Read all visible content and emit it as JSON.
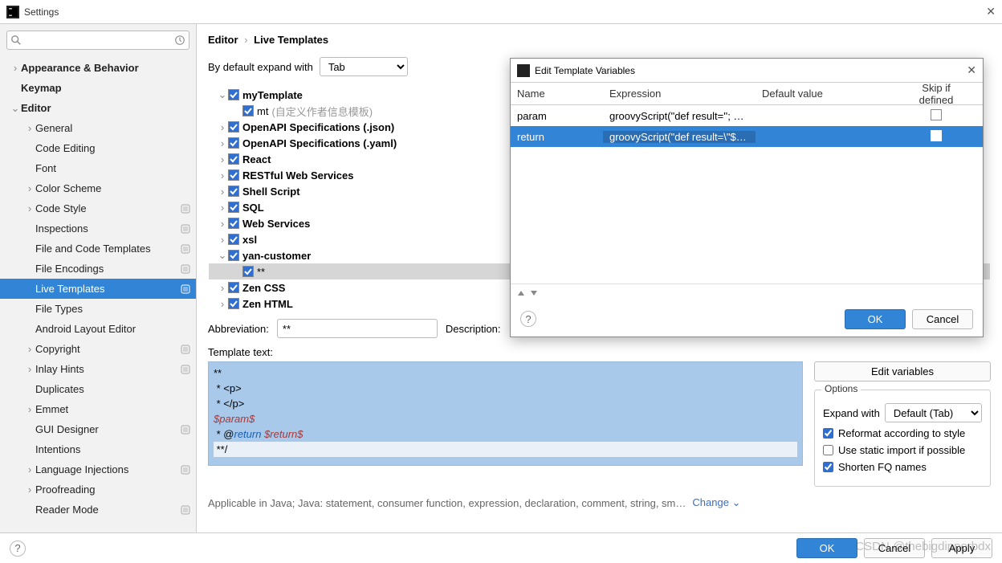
{
  "window": {
    "title": "Settings"
  },
  "breadcrumb": {
    "root": "Editor",
    "leaf": "Live Templates",
    "sep": "›"
  },
  "expand_row": {
    "label": "By default expand with",
    "value": "Tab"
  },
  "sidebar": {
    "items": [
      {
        "label": "Appearance & Behavior",
        "depth": 0,
        "chevron": "›",
        "bold": true,
        "badge": false
      },
      {
        "label": "Keymap",
        "depth": 0,
        "chevron": "",
        "bold": true,
        "badge": false
      },
      {
        "label": "Editor",
        "depth": 0,
        "chevron": "⌄",
        "bold": true,
        "badge": false
      },
      {
        "label": "General",
        "depth": 1,
        "chevron": "›",
        "bold": false,
        "badge": false
      },
      {
        "label": "Code Editing",
        "depth": 1,
        "chevron": "",
        "bold": false,
        "badge": false
      },
      {
        "label": "Font",
        "depth": 1,
        "chevron": "",
        "bold": false,
        "badge": false
      },
      {
        "label": "Color Scheme",
        "depth": 1,
        "chevron": "›",
        "bold": false,
        "badge": false
      },
      {
        "label": "Code Style",
        "depth": 1,
        "chevron": "›",
        "bold": false,
        "badge": true
      },
      {
        "label": "Inspections",
        "depth": 1,
        "chevron": "",
        "bold": false,
        "badge": true
      },
      {
        "label": "File and Code Templates",
        "depth": 1,
        "chevron": "",
        "bold": false,
        "badge": true
      },
      {
        "label": "File Encodings",
        "depth": 1,
        "chevron": "",
        "bold": false,
        "badge": true
      },
      {
        "label": "Live Templates",
        "depth": 1,
        "chevron": "",
        "bold": false,
        "badge": true,
        "selected": true
      },
      {
        "label": "File Types",
        "depth": 1,
        "chevron": "",
        "bold": false,
        "badge": false
      },
      {
        "label": "Android Layout Editor",
        "depth": 1,
        "chevron": "",
        "bold": false,
        "badge": false
      },
      {
        "label": "Copyright",
        "depth": 1,
        "chevron": "›",
        "bold": false,
        "badge": true
      },
      {
        "label": "Inlay Hints",
        "depth": 1,
        "chevron": "›",
        "bold": false,
        "badge": true
      },
      {
        "label": "Duplicates",
        "depth": 1,
        "chevron": "",
        "bold": false,
        "badge": false
      },
      {
        "label": "Emmet",
        "depth": 1,
        "chevron": "›",
        "bold": false,
        "badge": false
      },
      {
        "label": "GUI Designer",
        "depth": 1,
        "chevron": "",
        "bold": false,
        "badge": true
      },
      {
        "label": "Intentions",
        "depth": 1,
        "chevron": "",
        "bold": false,
        "badge": false
      },
      {
        "label": "Language Injections",
        "depth": 1,
        "chevron": "›",
        "bold": false,
        "badge": true
      },
      {
        "label": "Proofreading",
        "depth": 1,
        "chevron": "›",
        "bold": false,
        "badge": false
      },
      {
        "label": "Reader Mode",
        "depth": 1,
        "chevron": "",
        "bold": false,
        "badge": true
      }
    ]
  },
  "templates": [
    {
      "label": "myTemplate",
      "depth": 0,
      "chevron": "⌄",
      "bold": true
    },
    {
      "label": "mt",
      "depth": 1,
      "chevron": "",
      "bold": false,
      "desc": "(自定义作者信息模板)"
    },
    {
      "label": "OpenAPI Specifications (.json)",
      "depth": 0,
      "chevron": "›",
      "bold": true
    },
    {
      "label": "OpenAPI Specifications (.yaml)",
      "depth": 0,
      "chevron": "›",
      "bold": true
    },
    {
      "label": "React",
      "depth": 0,
      "chevron": "›",
      "bold": true
    },
    {
      "label": "RESTful Web Services",
      "depth": 0,
      "chevron": "›",
      "bold": true
    },
    {
      "label": "Shell Script",
      "depth": 0,
      "chevron": "›",
      "bold": true
    },
    {
      "label": "SQL",
      "depth": 0,
      "chevron": "›",
      "bold": true
    },
    {
      "label": "Web Services",
      "depth": 0,
      "chevron": "›",
      "bold": true
    },
    {
      "label": "xsl",
      "depth": 0,
      "chevron": "›",
      "bold": true
    },
    {
      "label": "yan-customer",
      "depth": 0,
      "chevron": "⌄",
      "bold": true
    },
    {
      "label": "**",
      "depth": 1,
      "chevron": "",
      "bold": false,
      "selected": true
    },
    {
      "label": "Zen CSS",
      "depth": 0,
      "chevron": "›",
      "bold": true
    },
    {
      "label": "Zen HTML",
      "depth": 0,
      "chevron": "›",
      "bold": true
    }
  ],
  "abbrev": {
    "label": "Abbreviation:",
    "value": "**",
    "desc_label": "Description:"
  },
  "template_text": {
    "label": "Template text:",
    "line1": "**",
    "line2": " * <p>",
    "line3": " * </p>",
    "line4": "$param$",
    "line5_a": " * @",
    "line5_kw": "return",
    "line5_b": " ",
    "line5_var": "$return$",
    "line6": " **/"
  },
  "right_panel": {
    "edit_vars": "Edit variables",
    "options_legend": "Options",
    "expand_label": "Expand with",
    "expand_value": "Default (Tab)",
    "opt_reformat": "Reformat according to style",
    "opt_static": "Use static import if possible",
    "opt_shorten": "Shorten FQ names"
  },
  "applicable": {
    "text": "Applicable in Java; Java: statement, consumer function, expression, declaration, comment, string, sm…",
    "link": "Change"
  },
  "buttons": {
    "ok": "OK",
    "cancel": "Cancel",
    "apply": "Apply"
  },
  "watermark": "CSDN @thebigdipperbdx",
  "dialog": {
    "title": "Edit Template Variables",
    "headers": {
      "name": "Name",
      "expr": "Expression",
      "def": "Default value",
      "skip": "Skip if defined"
    },
    "rows": [
      {
        "name": "param",
        "expr": "groovyScript(\"def result=''; d…",
        "def": "",
        "selected": false
      },
      {
        "name": "return",
        "expr": "groovyScript(\"def result=\\\"${…",
        "def": "",
        "selected": true
      }
    ],
    "ok": "OK",
    "cancel": "Cancel"
  }
}
